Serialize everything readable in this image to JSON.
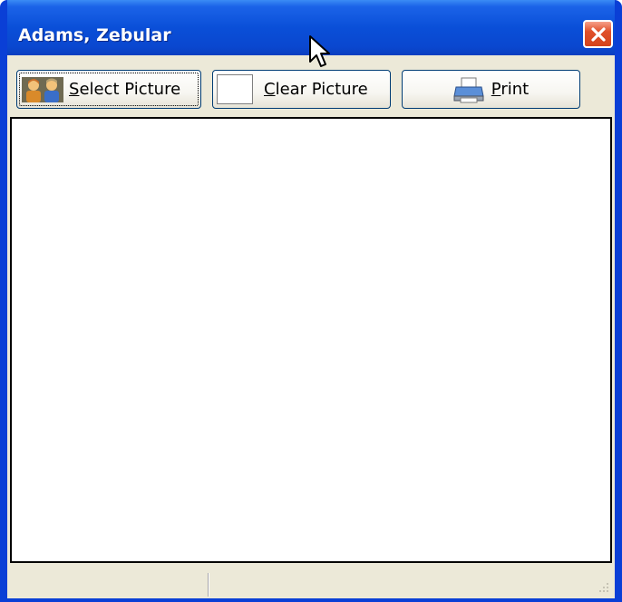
{
  "window": {
    "title": "Adams, Zebular"
  },
  "toolbar": {
    "select_picture": {
      "mnemonic": "S",
      "rest": "elect Picture",
      "icon": "people-icon"
    },
    "clear_picture": {
      "mnemonic": "C",
      "rest": "lear Picture",
      "icon": "blank-picture-icon"
    },
    "print": {
      "mnemonic": "P",
      "rest": "rint",
      "icon": "printer-icon"
    }
  },
  "colors": {
    "titlebar": "#0a4fd8",
    "close_button": "#d3431c",
    "face": "#ece9d8"
  }
}
